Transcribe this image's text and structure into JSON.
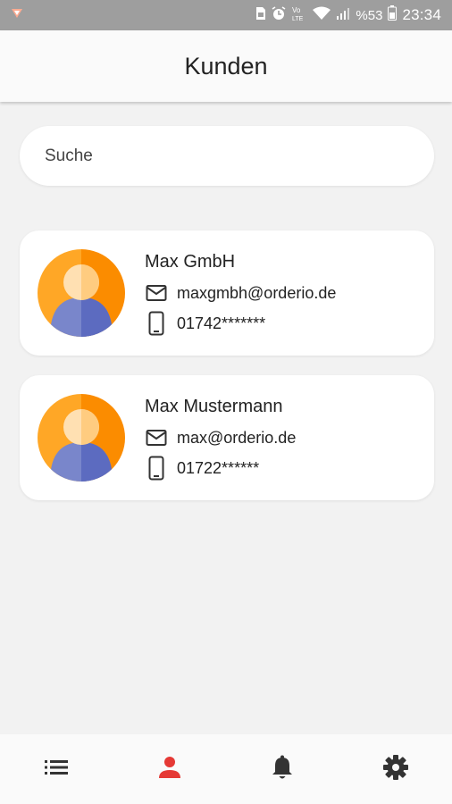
{
  "status_bar": {
    "signal_text": "VoLTE",
    "battery": "%53",
    "time": "23:34",
    "icons": [
      "app-notification-icon",
      "sim-icon",
      "alarm-icon",
      "volte-icon",
      "wifi-icon",
      "signal-icon",
      "battery-icon"
    ]
  },
  "header": {
    "title": "Kunden"
  },
  "search": {
    "placeholder": "Suche",
    "value": ""
  },
  "customers": [
    {
      "name": "Max GmbH",
      "email": "maxgmbh@orderio.de",
      "phone": "01742*******"
    },
    {
      "name": "Max Mustermann",
      "email": "max@orderio.de",
      "phone": "01722******"
    }
  ],
  "bottom_nav": {
    "items": [
      {
        "name": "orders",
        "icon": "list-icon",
        "active": false
      },
      {
        "name": "customers",
        "icon": "person-icon",
        "active": true
      },
      {
        "name": "notifications",
        "icon": "bell-icon",
        "active": false
      },
      {
        "name": "settings",
        "icon": "gear-icon",
        "active": false
      }
    ],
    "active_color": "#e53935",
    "inactive_color": "#333333"
  },
  "colors": {
    "status_bar": "#9e9e9e",
    "background": "#f2f2f2",
    "avatar_orange": "#ff9800",
    "avatar_skin": "#ffcc80",
    "avatar_body": "#5c6bc0"
  }
}
